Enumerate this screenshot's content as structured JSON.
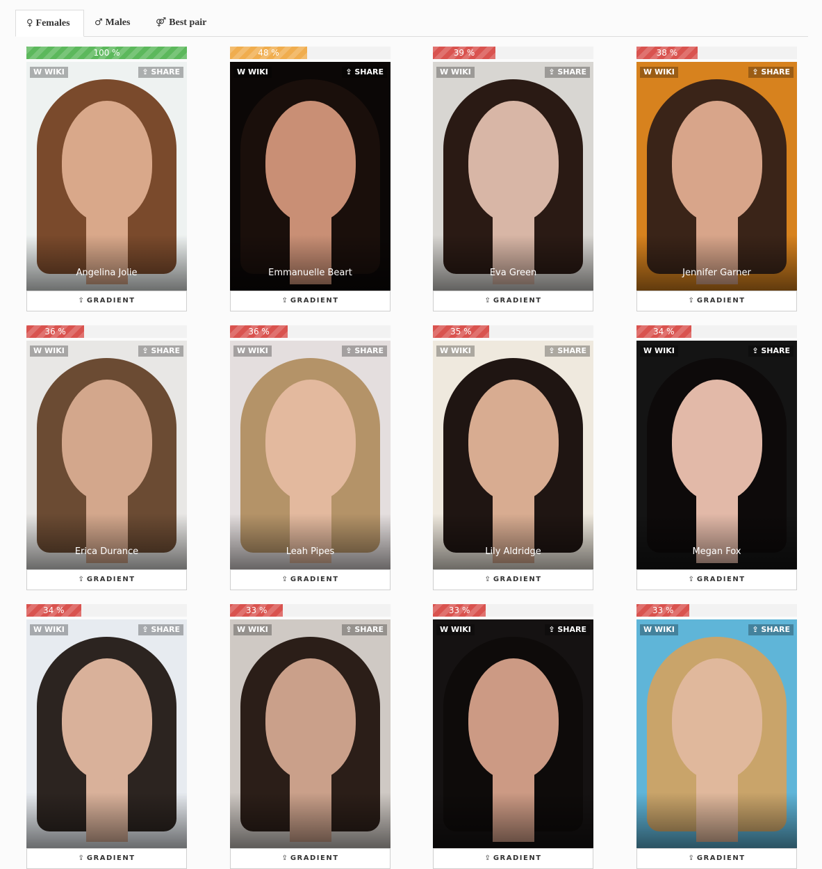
{
  "tabs": [
    {
      "icon": "♀",
      "icon_name": "female-icon",
      "label": "Females",
      "active": true
    },
    {
      "icon": "♂",
      "icon_name": "male-icon",
      "label": "Males",
      "active": false
    },
    {
      "icon": "⚤",
      "icon_name": "pair-icon",
      "label": "Best pair",
      "active": false
    }
  ],
  "labels": {
    "wiki": "WIKI",
    "share": "SHARE",
    "gradient": "GRADIENT"
  },
  "icons": {
    "wiki": "wiki-icon",
    "share": "share-icon",
    "gradient": "gradient-icon"
  },
  "colors": {
    "green": "#5cb85c",
    "orange": "#f0ad4e",
    "red": "#d9534f",
    "track": "#f2f2f2"
  },
  "cards": [
    {
      "name": "Angelina Jolie",
      "percent_text": "100 %",
      "percent": 100,
      "color": "#5cb85c",
      "bg": "#eef2f1",
      "hair": "#7a4a2c",
      "skin": "#d9a88a"
    },
    {
      "name": "Emmanuelle Beart",
      "percent_text": "48 %",
      "percent": 48,
      "color": "#f0ad4e",
      "bg": "#0b0706",
      "hair": "#1a0f0b",
      "skin": "#c98f75"
    },
    {
      "name": "Eva Green",
      "percent_text": "39 %",
      "percent": 39,
      "color": "#d9534f",
      "bg": "#d8d6d2",
      "hair": "#2a1a14",
      "skin": "#d8b6a6"
    },
    {
      "name": "Jennifer Garner",
      "percent_text": "38 %",
      "percent": 38,
      "color": "#d9534f",
      "bg": "#d7821e",
      "hair": "#3a2418",
      "skin": "#d8a58a"
    },
    {
      "name": "Erica Durance",
      "percent_text": "36 %",
      "percent": 36,
      "color": "#d9534f",
      "bg": "#e8e7e5",
      "hair": "#6b4b33",
      "skin": "#d3a78c"
    },
    {
      "name": "Leah Pipes",
      "percent_text": "36 %",
      "percent": 36,
      "color": "#d9534f",
      "bg": "#e4dede",
      "hair": "#b49368",
      "skin": "#e3b99e"
    },
    {
      "name": "Lily Aldridge",
      "percent_text": "35 %",
      "percent": 35,
      "color": "#d9534f",
      "bg": "#efe9de",
      "hair": "#1f1512",
      "skin": "#d8ac91"
    },
    {
      "name": "Megan Fox",
      "percent_text": "34 %",
      "percent": 34,
      "color": "#d9534f",
      "bg": "#141414",
      "hair": "#0d0a0a",
      "skin": "#e2b9a8"
    },
    {
      "name": "",
      "percent_text": "34 %",
      "percent": 34,
      "color": "#d9534f",
      "bg": "#e7ebf0",
      "hair": "#2c2420",
      "skin": "#d9b19a"
    },
    {
      "name": "",
      "percent_text": "33 %",
      "percent": 33,
      "color": "#d9534f",
      "bg": "#cfc9c4",
      "hair": "#2b1e18",
      "skin": "#caa08a"
    },
    {
      "name": "",
      "percent_text": "33 %",
      "percent": 33,
      "color": "#d9534f",
      "bg": "#151212",
      "hair": "#0e0b0a",
      "skin": "#cc9a84"
    },
    {
      "name": "",
      "percent_text": "33 %",
      "percent": 33,
      "color": "#d9534f",
      "bg": "#5fb5d8",
      "hair": "#c9a46a",
      "skin": "#e0b89c"
    }
  ]
}
